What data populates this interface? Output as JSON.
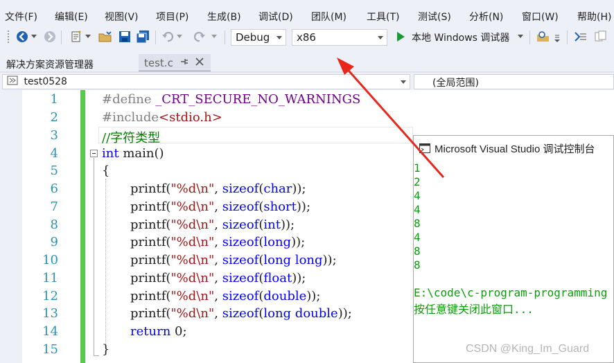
{
  "menu": [
    "文件(F)",
    "编辑(E)",
    "视图(V)",
    "项目(P)",
    "生成(B)",
    "调试(D)",
    "团队(M)",
    "工具(T)",
    "测试(S)",
    "分析(N)",
    "窗口(W)",
    "帮助(H)"
  ],
  "toolbar": {
    "config": "Debug",
    "platform": "x86",
    "run_label": "本地 Windows 调试器"
  },
  "panel_title": "解决方案资源管理器",
  "doc_tab": "test.c",
  "nav": {
    "project": "test0528",
    "scope": "(全局范围)"
  },
  "code": {
    "line_numbers": [
      "1",
      "2",
      "3",
      "4",
      "5",
      "6",
      "7",
      "8",
      "9",
      "10",
      "11",
      "12",
      "13",
      "14",
      "15"
    ],
    "l1_pre": "#define ",
    "l1_macro": "_CRT_SECURE_NO_WARNINGS",
    "l2_pre": "#include",
    "l2_str": "<stdio.h>",
    "l3": "//字符类型",
    "l4_kw": "int",
    "l4_rest": " main()",
    "l5": "{",
    "printf": "printf(",
    "fmt": "\"%d\\n\"",
    "comma": ", ",
    "sizeof": "sizeof",
    "types": [
      "char",
      "short",
      "int",
      "long",
      "long long",
      "float",
      "double",
      "long double"
    ],
    "close": ");",
    "l14_kw": "return",
    "l14_rest": " 0;",
    "l15": "}"
  },
  "console": {
    "title": "Microsoft Visual Studio 调试控制台",
    "output": [
      "1",
      "2",
      "4",
      "4",
      "8",
      "4",
      "8",
      "8"
    ],
    "path_line": "E:\\code\\c-program-programming",
    "prompt": "按任意键关闭此窗口..."
  },
  "watermark": "CSDN @King_Im_Guard",
  "colors": {
    "arrow": "#e8261c",
    "console_text": "#0a9d0a",
    "change_bar": "#57c94b"
  }
}
